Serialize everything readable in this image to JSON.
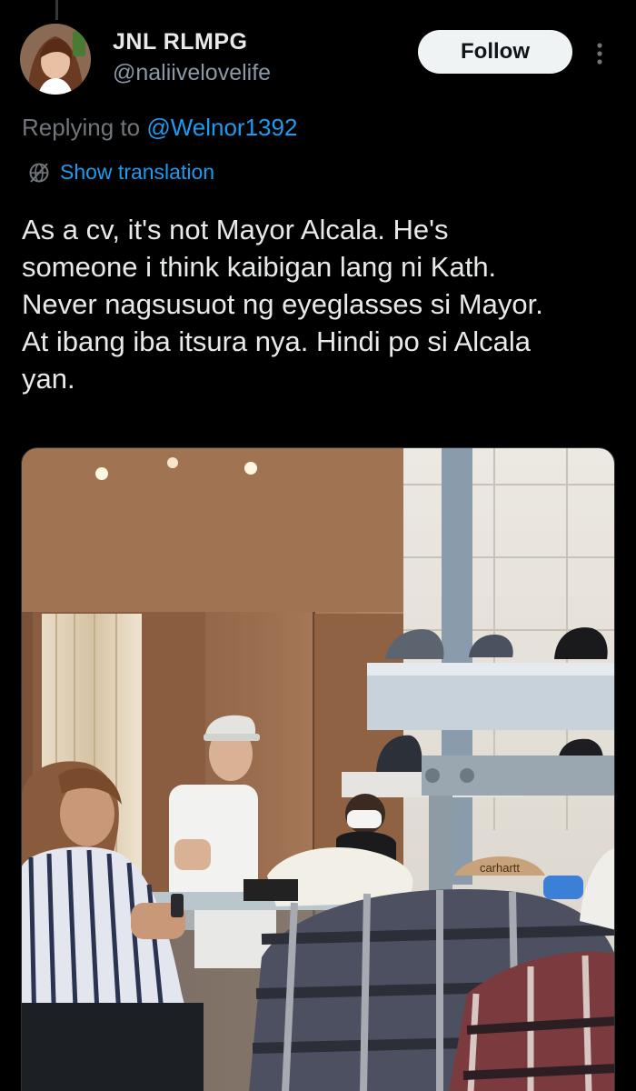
{
  "tweet": {
    "author": {
      "display_name": "JNL RLMPG",
      "handle": "@naliivelovelife",
      "avatar_icon": "profile-photo"
    },
    "follow_label": "Follow",
    "more_icon": "more-vertical-icon",
    "replying_prefix": "Replying to",
    "replying_to": "@Welnor1392",
    "translation_label": "Show translation",
    "translation_icon": "globe-icon",
    "text": "As a cv, it's not Mayor Alcala. He's\nsomeone i think kaibigan lang ni Kath.\nNever nagsusuot ng eyeglasses si Mayor.\nAt ibang iba itsura nya. Hindi po si Alcala\nyan.",
    "photo": {
      "tag_text": "carhartt"
    }
  },
  "colors": {
    "background": "#000000",
    "text_primary": "#e7e9ea",
    "text_secondary": "#71767b",
    "link": "#1d9bf0",
    "follow_bg": "#eff3f4"
  }
}
